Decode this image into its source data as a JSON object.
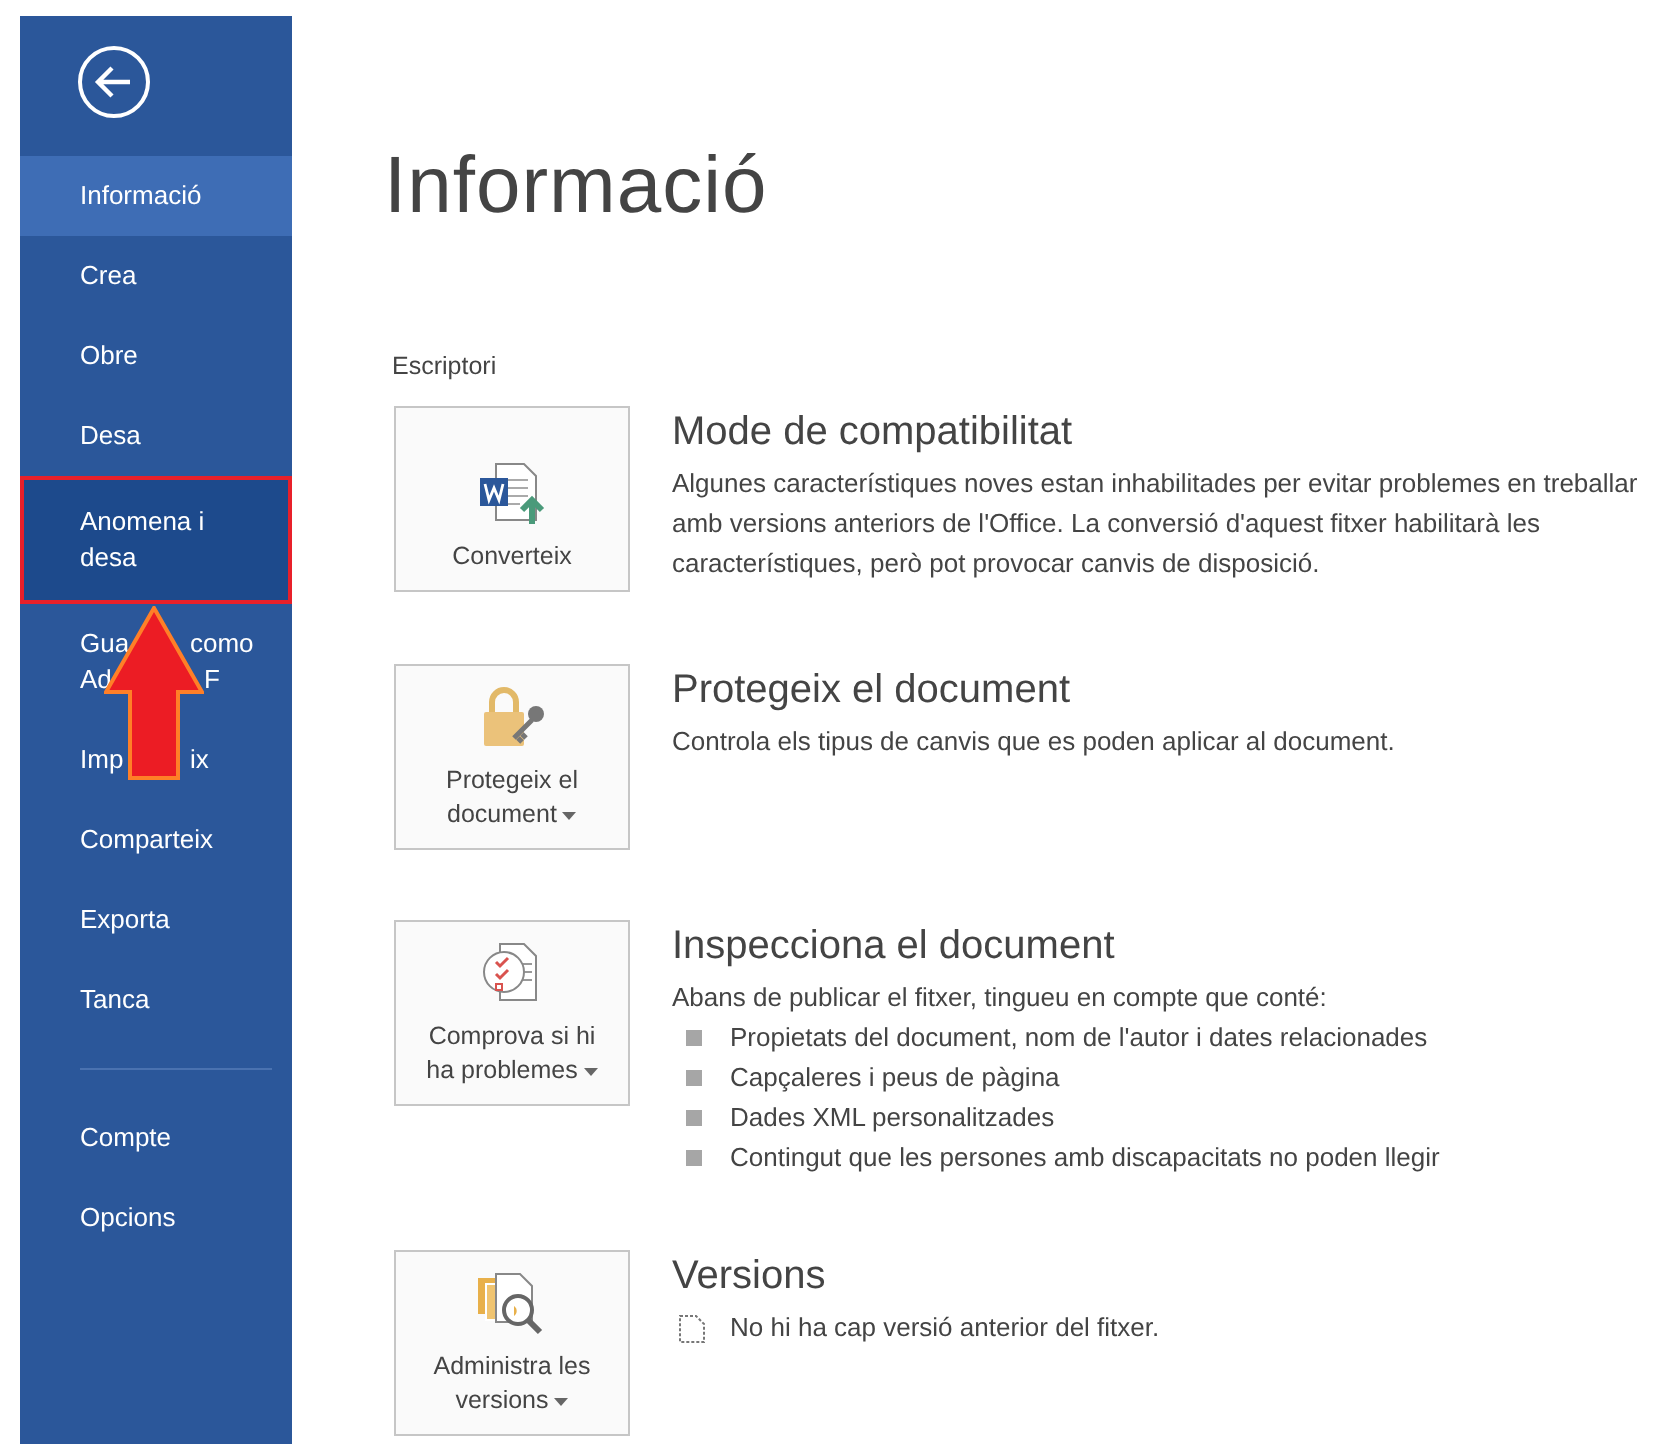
{
  "sidebar": {
    "items": [
      {
        "label_lines": [
          [
            "Informació"
          ]
        ],
        "selected": true,
        "hovered": false,
        "outlined": false
      },
      {
        "label_lines": [
          [
            "Crea"
          ]
        ],
        "selected": false,
        "hovered": false,
        "outlined": false
      },
      {
        "label_lines": [
          [
            "Obre"
          ]
        ],
        "selected": false,
        "hovered": false,
        "outlined": false
      },
      {
        "label_lines": [
          [
            "Desa"
          ]
        ],
        "selected": false,
        "hovered": false,
        "outlined": false
      },
      {
        "label_lines": [
          [
            "Anomena i"
          ],
          [
            "desa"
          ]
        ],
        "selected": false,
        "hovered": true,
        "outlined": true
      },
      {
        "label_lines": [
          [
            "Gua",
            "como"
          ],
          [
            "Ad",
            "F"
          ]
        ],
        "selected": false,
        "hovered": false,
        "outlined": false
      },
      {
        "label_lines": [
          [
            "Imp",
            "ix"
          ]
        ],
        "selected": false,
        "hovered": false,
        "outlined": false
      },
      {
        "label_lines": [
          [
            "Comparteix"
          ]
        ],
        "selected": false,
        "hovered": false,
        "outlined": false
      },
      {
        "label_lines": [
          [
            "Exporta"
          ]
        ],
        "selected": false,
        "hovered": false,
        "outlined": false
      },
      {
        "label_lines": [
          [
            "Tanca"
          ]
        ],
        "selected": false,
        "hovered": false,
        "outlined": false
      }
    ],
    "bottom_items": [
      {
        "label_lines": [
          [
            "Compte"
          ]
        ],
        "selected": false,
        "hovered": false,
        "outlined": false
      },
      {
        "label_lines": [
          [
            "Opcions"
          ]
        ],
        "selected": false,
        "hovered": false,
        "outlined": false
      }
    ]
  },
  "page_title": "Informació",
  "location": "Escriptori",
  "sections": [
    {
      "kind": "convert",
      "button_lines": [
        "Converteix"
      ],
      "dropdown": false,
      "heading": "Mode de compatibilitat",
      "description": "Algunes característiques noves estan inhabilitades per evitar problemes en treballar amb versions anteriors de l'Office. La conversió d'aquest fitxer habilitarà les característiques, però pot provocar canvis de disposició."
    },
    {
      "kind": "protect",
      "button_lines": [
        "Protegeix el",
        "document"
      ],
      "dropdown": true,
      "heading": "Protegeix el document",
      "description": "Controla els tipus de canvis que es poden aplicar al document."
    },
    {
      "kind": "inspect",
      "button_lines": [
        "Comprova si hi",
        "ha problemes"
      ],
      "dropdown": true,
      "heading": "Inspecciona el document",
      "description": "Abans de publicar el fitxer, tingueu en compte que conté:",
      "bullets": [
        "Propietats del document, nom de l'autor i dates relacionades",
        "Capçaleres i peus de pàgina",
        "Dades XML personalitzades",
        "Contingut que les persones amb discapacitats no poden llegir"
      ]
    },
    {
      "kind": "versions",
      "button_lines": [
        "Administra les",
        "versions"
      ],
      "dropdown": true,
      "heading": "Versions",
      "note": "No hi ha cap versió anterior del fitxer."
    }
  ]
}
